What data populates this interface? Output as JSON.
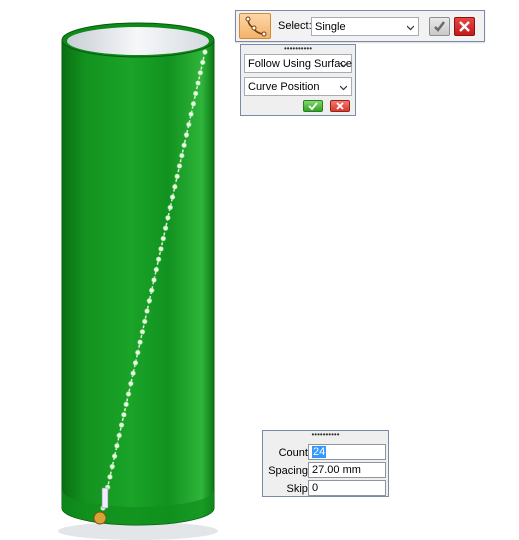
{
  "select_toolbar": {
    "tool_icon": "path-select-icon",
    "label": "Select:",
    "dropdown_value": "Single",
    "accept_icon": "checkmark-icon",
    "cancel_icon": "close-x-icon"
  },
  "follow_panel": {
    "follow_dropdown": "Follow Using Surface",
    "position_dropdown": "Curve Position",
    "accept_icon": "checkmark-icon",
    "cancel_icon": "close-x-icon"
  },
  "pattern_panel": {
    "count_label": "Count:",
    "count_value": "24",
    "spacing_label": "Spacing:",
    "spacing_value": "27.00 mm",
    "skip_label": "Skip:",
    "skip_value": "0"
  },
  "colors": {
    "cylinder_green": "#0f8a1a",
    "cylinder_dark": "#075a10",
    "panel_bg": "#efefef",
    "panel_border": "#7a8aa8"
  }
}
